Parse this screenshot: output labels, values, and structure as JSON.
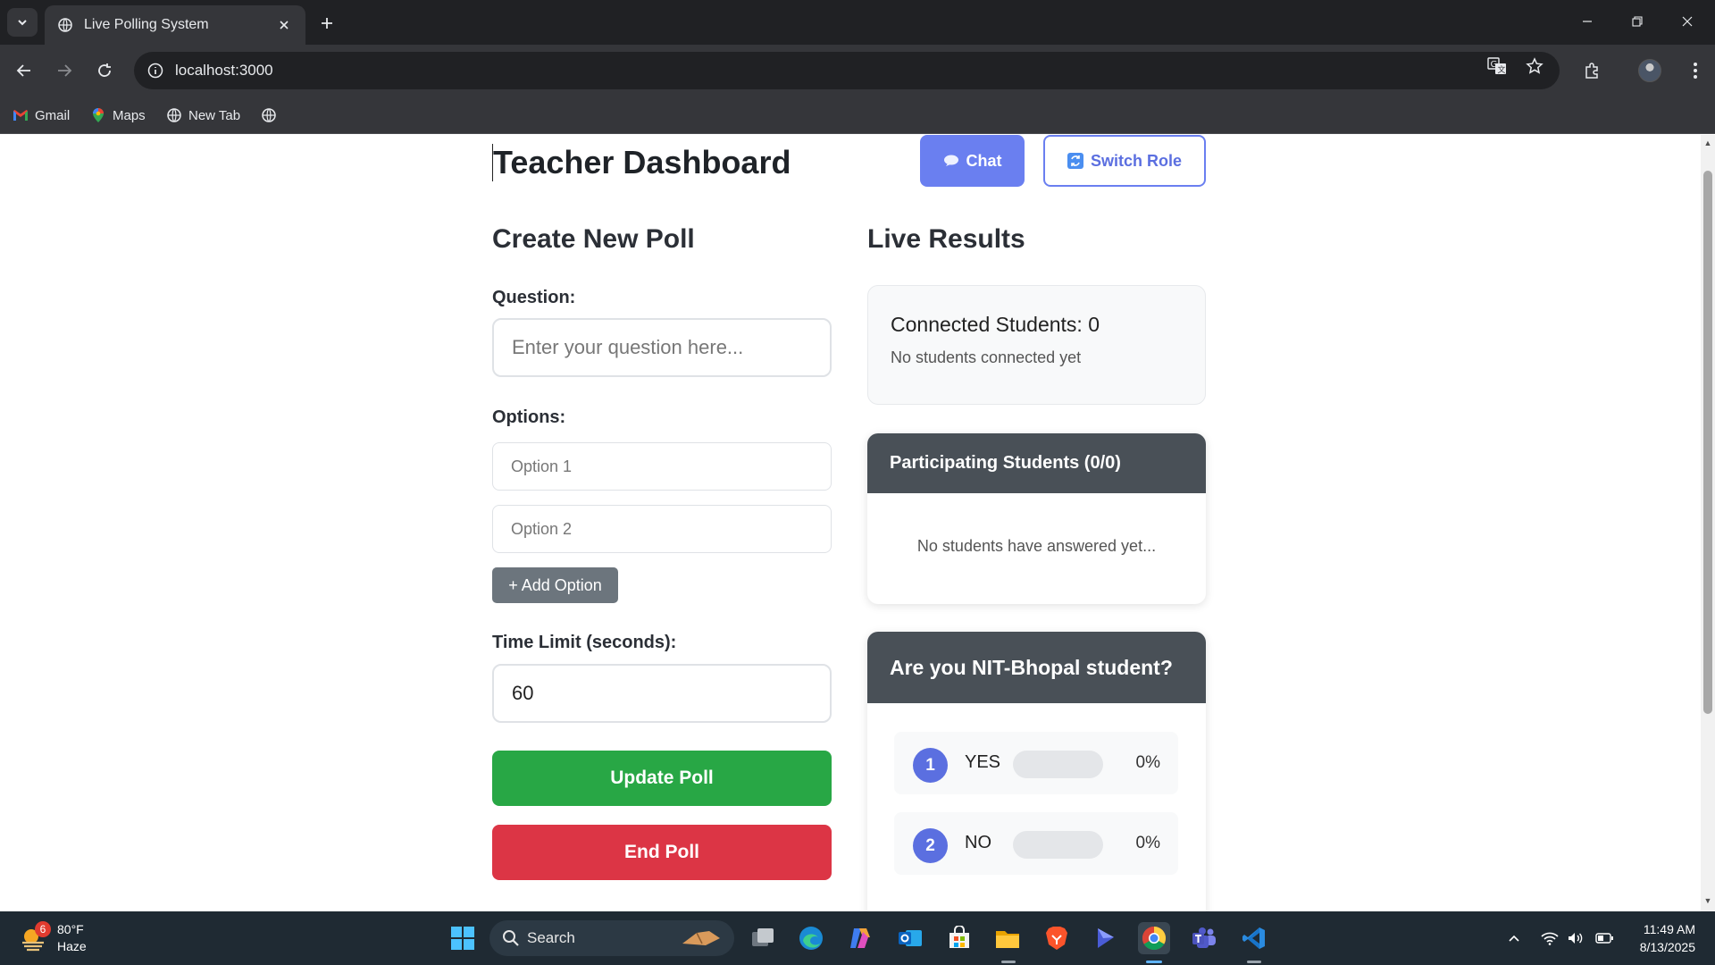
{
  "browser": {
    "tab_title": "Live Polling System",
    "url": "localhost:3000",
    "bookmarks": [
      "Gmail",
      "Maps",
      "New Tab"
    ]
  },
  "header": {
    "title": "Teacher Dashboard",
    "chat_label": "Chat",
    "switch_role_label": "Switch Role"
  },
  "create_poll": {
    "heading": "Create New Poll",
    "question_label": "Question:",
    "question_placeholder": "Enter your question here...",
    "options_label": "Options:",
    "option1_placeholder": "Option 1",
    "option2_placeholder": "Option 2",
    "add_option_label": "+ Add Option",
    "time_label": "Time Limit (seconds):",
    "time_value": "60",
    "update_label": "Update Poll",
    "end_label": "End Poll"
  },
  "results": {
    "heading": "Live Results",
    "connected_title": "Connected Students: 0",
    "connected_sub": "No students connected yet",
    "participating_title": "Participating Students (0/0)",
    "participating_empty": "No students have answered yet...",
    "poll_question": "Are you NIT-Bhopal student?",
    "options": [
      {
        "num": "1",
        "text": "YES",
        "pct": "0%",
        "fill": 0
      },
      {
        "num": "2",
        "text": "NO",
        "pct": "0%",
        "fill": 0
      }
    ]
  },
  "taskbar": {
    "weather_badge": "6",
    "weather_temp": "80°F",
    "weather_cond": "Haze",
    "search_label": "Search",
    "time": "11:49 AM",
    "date": "8/13/2025"
  },
  "colors": {
    "accent": "#5b6fe0",
    "success": "#28a745",
    "danger": "#dc3545",
    "card_header": "#495057"
  }
}
